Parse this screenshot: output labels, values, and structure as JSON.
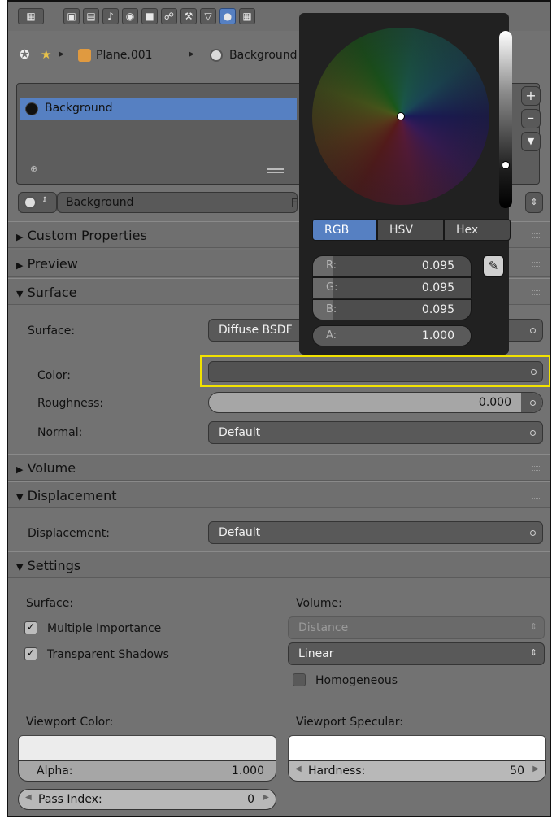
{
  "breadcrumb": {
    "object": "Plane.001",
    "world": "Background"
  },
  "world_list": {
    "item": "Background"
  },
  "world_selector": {
    "name": "Background",
    "flag": "F"
  },
  "sections": {
    "custom_properties": "Custom Properties",
    "preview": "Preview",
    "surface": "Surface",
    "volume": "Volume",
    "displacement": "Displacement",
    "settings": "Settings"
  },
  "surface": {
    "surface_label": "Surface:",
    "surface_value": "Diffuse BSDF",
    "color_label": "Color:",
    "roughness_label": "Roughness:",
    "roughness_value": "0.000",
    "normal_label": "Normal:",
    "normal_value": "Default"
  },
  "displacement": {
    "label": "Displacement:",
    "value": "Default"
  },
  "settings": {
    "surface_heading": "Surface:",
    "volume_heading": "Volume:",
    "multiple_importance": "Multiple Importance",
    "transparent_shadows": "Transparent Shadows",
    "volume_sampling": "Distance",
    "volume_interpolation": "Linear",
    "homogeneous": "Homogeneous",
    "viewport_color_label": "Viewport Color:",
    "viewport_specular_label": "Viewport Specular:",
    "alpha_label": "Alpha:",
    "alpha_value": "1.000",
    "hardness_label": "Hardness:",
    "hardness_value": "50",
    "pass_index_label": "Pass Index:",
    "pass_index_value": "0"
  },
  "color_picker": {
    "tabs": [
      "RGB",
      "HSV",
      "Hex"
    ],
    "active_tab": "RGB",
    "channels": [
      {
        "label": "R:",
        "value": "0.095"
      },
      {
        "label": "G:",
        "value": "0.095"
      },
      {
        "label": "B:",
        "value": "0.095"
      },
      {
        "label": "A:",
        "value": "1.000"
      }
    ]
  },
  "colors": {
    "accent": "#5680c2",
    "highlight": "#f2e200",
    "panel": "#727272",
    "popup": "#212121"
  }
}
